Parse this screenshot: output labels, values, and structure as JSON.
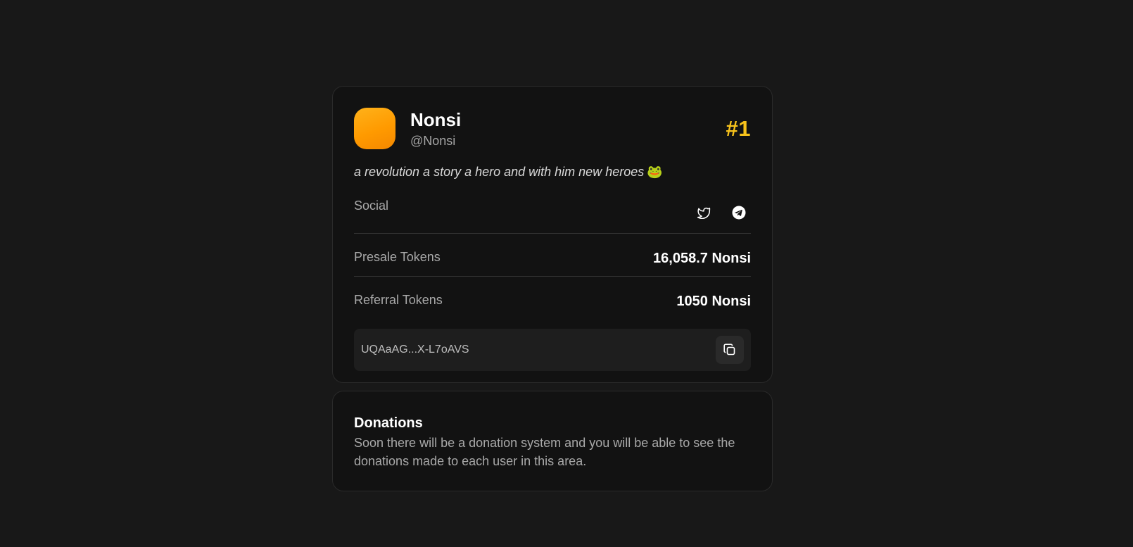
{
  "profile": {
    "display_name": "Nonsi",
    "handle": "@Nonsi",
    "rank": "#1",
    "bio": "a revolution a story a hero and with him new heroes",
    "bio_emoji": "🐸",
    "avatar_colors": [
      "#ffb21a",
      "#f58800"
    ],
    "accent_color": "#f7c21b"
  },
  "social": {
    "label": "Social",
    "icons": [
      "twitter-icon",
      "telegram-icon"
    ]
  },
  "stats": [
    {
      "label": "Presale Tokens",
      "value": "16,058.7 Nonsi"
    },
    {
      "label": "Referral Tokens",
      "value": "1050 Nonsi"
    }
  ],
  "address": {
    "text": "UQAaAG...X-L7oAVS",
    "copy_icon": "copy-icon"
  },
  "donations": {
    "title": "Donations",
    "text": "Soon there will be a donation system and you will be able to see the donations made to each user in this area."
  }
}
